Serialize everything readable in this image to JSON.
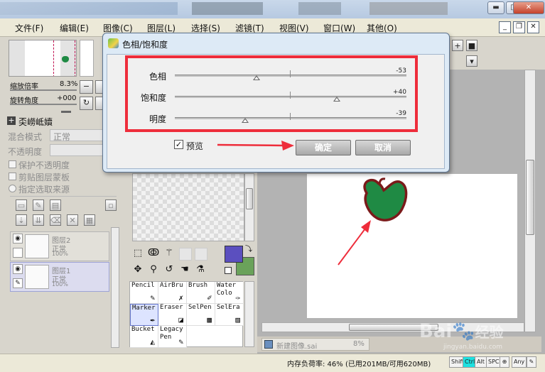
{
  "menu": {
    "items": [
      "文件(F)",
      "编辑(E)",
      "图像(C)",
      "图层(L)",
      "选择(S)",
      "滤镜(T)",
      "视图(V)",
      "窗口(W)",
      "其他(O)"
    ]
  },
  "window_controls": {
    "minimize": "▬",
    "maximize": "□",
    "close": "✕"
  },
  "mdi_controls": {
    "minimize": "_",
    "restore": "❐",
    "close": "✕"
  },
  "navigator": {
    "zoom_label": "缩放倍率",
    "zoom_value": "8.3%",
    "rotate_label": "旋转角度",
    "rotate_value": "+000"
  },
  "layer_panel": {
    "header_icon": "plus-box-icon",
    "header_title": "奀嶗岻嬻",
    "blend_mode_label": "混合模式",
    "blend_mode_value": "正常",
    "opacity_label": "不透明度",
    "protect_opacity": "保护不透明度",
    "clipping_mask": "剪贴图层蒙板",
    "selection_source": "指定选取来源",
    "layers": [
      {
        "name": "图层2",
        "mode": "正常",
        "opacity": "100%"
      },
      {
        "name": "图层1",
        "mode": "正常",
        "opacity": "100%"
      }
    ]
  },
  "tools": {
    "brushes": [
      [
        "Pencil",
        "AirBru",
        "Brush",
        "Water Colo"
      ],
      [
        "Marker",
        "Eraser",
        "SelPen",
        "SelEra"
      ],
      [
        "Bucket",
        "Legacy Pen",
        "",
        ""
      ]
    ],
    "primary_color": "#5b4fbf",
    "secondary_color": "#6aa25a"
  },
  "dialog": {
    "title": "色相/饱和度",
    "sliders": [
      {
        "label": "色相",
        "value": "-53",
        "level": -53,
        "min": -180,
        "max": 180
      },
      {
        "label": "饱和度",
        "value": "+40",
        "level": 40,
        "min": -100,
        "max": 100
      },
      {
        "label": "明度",
        "value": "-39",
        "level": -39,
        "min": -100,
        "max": 100
      }
    ],
    "preview_label": "预览",
    "preview_checked": true,
    "ok_label": "确定",
    "cancel_label": "取消",
    "highlight_color": "#ee2d3b"
  },
  "document_tab": {
    "name": "新建图像.sai",
    "zoom": "8%"
  },
  "status": {
    "memory_text": "内存负荷率: 46% (已用201MB/可用620MB)",
    "keys": [
      "Shift",
      "Ctrl",
      "Alt",
      "SPC",
      "Any"
    ]
  },
  "watermark": {
    "brand": "Bai",
    "suffix": "经验",
    "url": "jingyan.baidu.com"
  },
  "apple_color": "#1f8a44",
  "apple_outline": "#7a1a1a"
}
